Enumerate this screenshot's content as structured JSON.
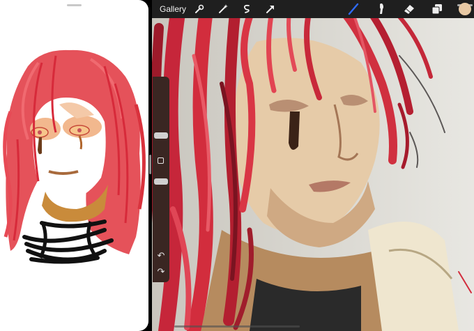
{
  "toolbar": {
    "gallery_label": "Gallery",
    "left_tools": [
      "wrench-icon",
      "magic-wand-icon",
      "selection-icon",
      "transform-arrow-icon"
    ],
    "right_tools": [
      "brush-icon",
      "smudge-icon",
      "eraser-icon",
      "layers-icon"
    ],
    "current_color": "#e8c9a4",
    "brush_active_color": "#2f6bff"
  },
  "sidebar": {
    "controls": [
      "brush-size-slider",
      "modify-button",
      "opacity-slider",
      "undo-button",
      "redo-button"
    ]
  },
  "colors": {
    "hair_red": "#d72a3a",
    "skin": "#e9c7a3",
    "canvas_bg": "#d9d8d2"
  }
}
